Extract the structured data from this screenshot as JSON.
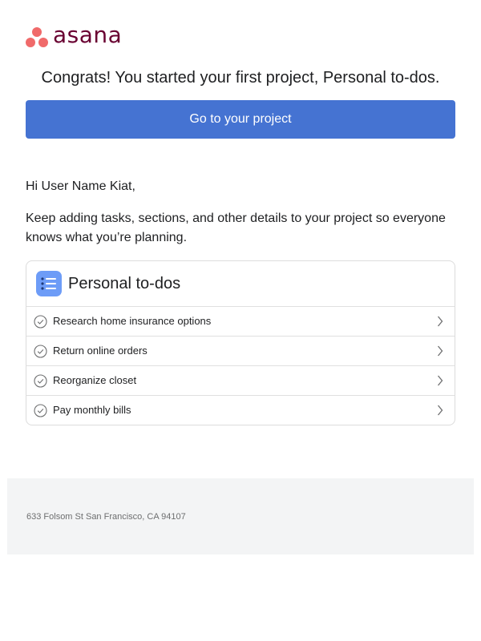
{
  "brand": {
    "logo_text": "asana",
    "logo_color": "#690031",
    "dot_color": "#f06a6a"
  },
  "headline": "Congrats! You started your first project, Personal to-dos.",
  "cta": {
    "label": "Go to your project",
    "color": "#4573d2"
  },
  "greeting": "Hi User Name Kiat,",
  "body_text": "Keep adding tasks, sections, and other details to your project so everyone knows what you’re planning.",
  "project": {
    "icon": "list-icon",
    "icon_color": "#6d9cf7",
    "title": "Personal to-dos",
    "tasks": [
      {
        "label": "Research home insurance options",
        "icon": "check-circle-icon"
      },
      {
        "label": "Return online orders",
        "icon": "check-circle-icon"
      },
      {
        "label": "Reorganize closet",
        "icon": "check-circle-icon"
      },
      {
        "label": "Pay monthly bills",
        "icon": "check-circle-icon"
      }
    ]
  },
  "footer": {
    "address": "633 Folsom St San Francisco, CA 94107"
  }
}
